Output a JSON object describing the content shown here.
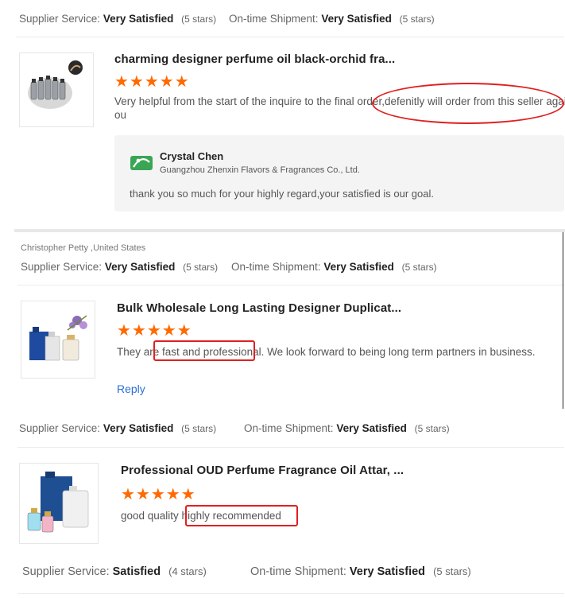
{
  "review1": {
    "rating": {
      "supplier_label": "Supplier Service:",
      "supplier_value": "Very Satisfied",
      "supplier_stars": "(5 stars)",
      "shipment_label": "On-time Shipment:",
      "shipment_value": "Very Satisfied",
      "shipment_stars": "(5 stars)"
    },
    "product_title": "charming designer perfume oil black-orchid fra...",
    "stars": "★★★★★",
    "comment_line1": "Very helpful from the start of the inquire to the final order,defenitly will order from this seller again",
    "comment_line2": "ou",
    "reply": {
      "name": "Crystal Chen",
      "company": "Guangzhou Zhenxin Flavors & Fragrances Co., Ltd.",
      "text": "thank you so much for your highly regard,your satisfied is our goal."
    }
  },
  "review2": {
    "reviewer": "Christopher Petty ,United States",
    "rating": {
      "supplier_label": "Supplier Service:",
      "supplier_value": "Very Satisfied",
      "supplier_stars": "(5 stars)",
      "shipment_label": "On-time Shipment:",
      "shipment_value": "Very Satisfied",
      "shipment_stars": "(5 stars)"
    },
    "product_title": "Bulk Wholesale Long Lasting Designer Duplicat...",
    "stars": "★★★★★",
    "comment": "They are fast and professional. We look forward to being long term partners in business.",
    "reply_label": "Reply"
  },
  "review3": {
    "rating": {
      "supplier_label": "Supplier Service:",
      "supplier_value": "Very Satisfied",
      "supplier_stars": "(5 stars)",
      "shipment_label": "On-time Shipment:",
      "shipment_value": "Very Satisfied",
      "shipment_stars": "(5 stars)"
    },
    "product_title": "Professional OUD Perfume Fragrance Oil Attar, ...",
    "stars": "★★★★★",
    "comment": "good quality highly recommended"
  },
  "review4": {
    "rating": {
      "supplier_label": "Supplier Service:",
      "supplier_value": "Satisfied",
      "supplier_stars": "(4 stars)",
      "shipment_label": "On-time Shipment:",
      "shipment_value": "Very Satisfied",
      "shipment_stars": "(5 stars)"
    }
  },
  "colors": {
    "star": "#ff6a00",
    "annotation": "#e02020",
    "link": "#2b6fd6"
  }
}
